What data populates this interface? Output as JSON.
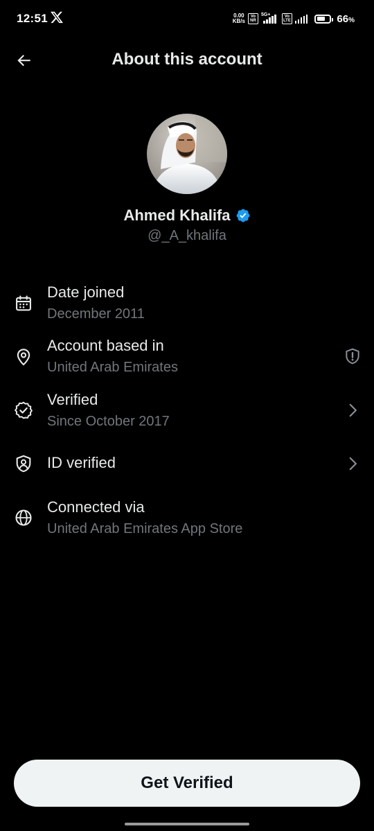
{
  "status_bar": {
    "time": "12:51",
    "net_speed_value": "0.00",
    "net_speed_unit": "KB/s",
    "volte_tag_1": "Vo",
    "volte_tag_1b": "NR",
    "network_type": "5G+",
    "volte_tag_2": "Vo",
    "volte_tag_2b": "LTE",
    "battery_percent": "66",
    "battery_percent_symbol": "%",
    "battery_level": 0.66
  },
  "header": {
    "title": "About this account"
  },
  "profile": {
    "display_name": "Ahmed Khalifa",
    "handle": "@_A_khalifa"
  },
  "info": {
    "date_joined": {
      "title": "Date joined",
      "value": "December 2011",
      "icon": "calendar-icon"
    },
    "account_based_in": {
      "title": "Account based in",
      "value": "United Arab Emirates",
      "icon": "location-pin-icon",
      "trailing_icon": "shield-alert-icon"
    },
    "verified": {
      "title": "Verified",
      "value": "Since October 2017",
      "icon": "verified-badge-outline-icon",
      "trailing_icon": "chevron-right-icon"
    },
    "id_verified": {
      "title": "ID verified",
      "icon": "id-badge-shield-icon",
      "trailing_icon": "chevron-right-icon"
    },
    "connected_via": {
      "title": "Connected via",
      "value": "United Arab Emirates App Store",
      "icon": "globe-icon"
    }
  },
  "cta": {
    "label": "Get Verified"
  },
  "colors": {
    "background": "#000000",
    "primary_text": "#e7e9ea",
    "secondary_text": "#71767b",
    "verified_blue": "#1d9bf0",
    "button_bg": "#eff3f4",
    "button_text": "#0f1419"
  }
}
